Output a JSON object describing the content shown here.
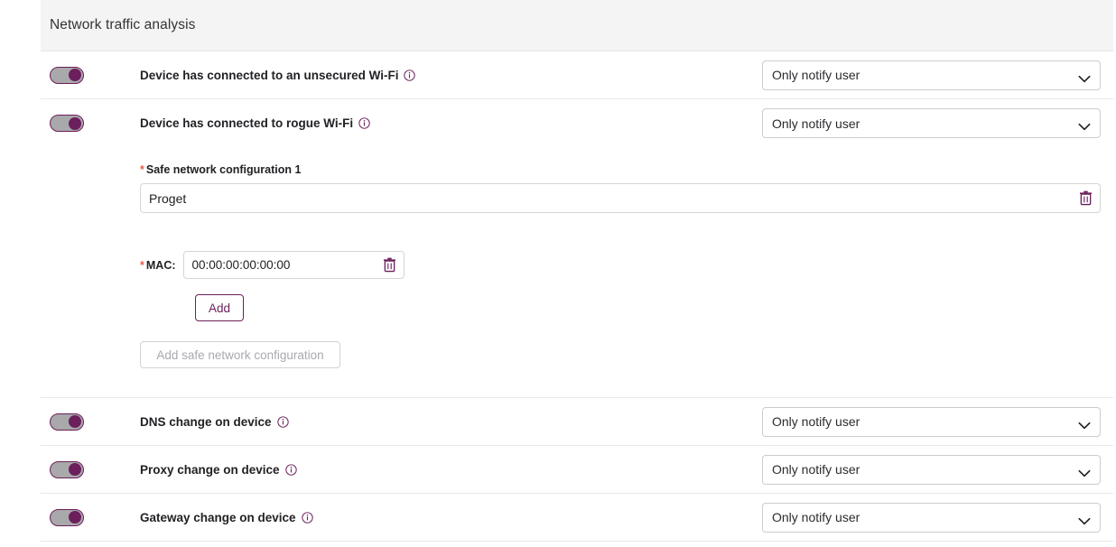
{
  "card": {
    "title": "Network traffic analysis"
  },
  "rows": [
    {
      "label": "Device has connected to an unsecured Wi-Fi",
      "toggle_on": true,
      "select_value": "Only notify user"
    },
    {
      "label": "Device has connected to rogue Wi-Fi",
      "toggle_on": true,
      "select_value": "Only notify user"
    },
    {
      "label": "DNS change on device",
      "toggle_on": true,
      "select_value": "Only notify user"
    },
    {
      "label": "Proxy change on device",
      "toggle_on": true,
      "select_value": "Only notify user"
    },
    {
      "label": "Gateway change on device",
      "toggle_on": true,
      "select_value": "Only notify user"
    }
  ],
  "safe_network": {
    "required_marker": "*",
    "config_label": "Safe network configuration 1",
    "config_value": "Proget",
    "config_placeholder": "",
    "mac_label": "MAC:",
    "mac_value": "00:00:00:00:00:00",
    "mac_placeholder": "",
    "add_label": "Add",
    "add_config_label": "Add safe network configuration"
  },
  "icons": {
    "info": "info-circle-icon",
    "chevron": "chevron-down-icon",
    "trash": "trash-icon"
  },
  "colors": {
    "accent": "#6b1f5c",
    "required": "#e8604c",
    "header_bg": "#f4f4f4",
    "toggle_track": "#a9a8aa",
    "disabled_text": "#a9a9b0"
  }
}
